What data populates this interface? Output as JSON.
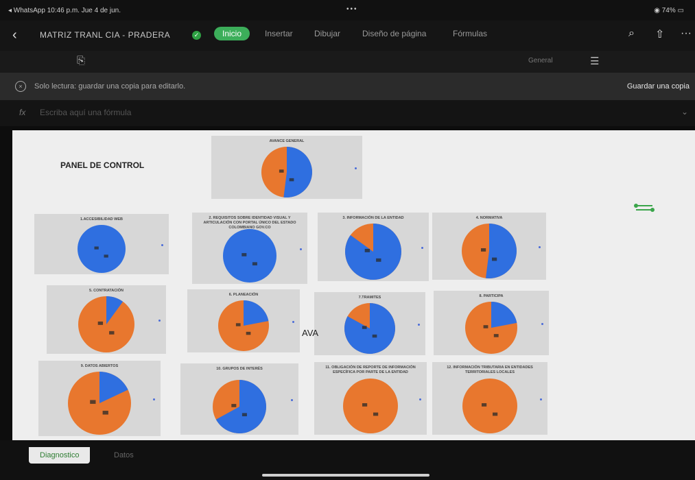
{
  "status": {
    "left": "◂ WhatsApp  10:46 p.m.  Jue 4 de jun.",
    "center": "•••",
    "right": "74%"
  },
  "title": {
    "doc": "MATRIZ TRANL CIA - PRADERA"
  },
  "tabs": [
    "Inicio",
    "Insertar",
    "Dibujar",
    "Diseño de página",
    "Fórmulas"
  ],
  "toolbar": {
    "general": "General"
  },
  "banner": {
    "message": "Solo lectura: guardar una copia para editarlo.",
    "save_copy": "Guardar una copia"
  },
  "formula": {
    "fx": "fx",
    "placeholder": "Escriba aquí una fórmula"
  },
  "sheet": {
    "panel_title": "PANEL DE CONTROL",
    "overlay_text": "AVA",
    "charts": [
      {
        "title": "AVANCE GENERAL",
        "blue": 0.52
      },
      {
        "title": "1.ACCESIBILIDAD WEB",
        "blue": 1.0
      },
      {
        "title": "2. REQUISITOS SOBRE IDENTIDAD VISUAL Y ARTICULACIÓN CON PORTAL ÚNICO DEL ESTADO COLOMBIANO GOV.CO",
        "blue": 1.0
      },
      {
        "title": "3. INFORMACIÓN DE LA ENTIDAD",
        "blue": 0.85
      },
      {
        "title": "4. NORMATIVA",
        "blue": 0.52
      },
      {
        "title": "5. CONTRATACIÓN",
        "blue": 0.1
      },
      {
        "title": "6. PLANEACIÓN",
        "blue": 0.22
      },
      {
        "title": "7.TRAMITES",
        "blue": 0.83
      },
      {
        "title": "8. PARTICIPA",
        "blue": 0.22
      },
      {
        "title": "9. DATOS ABIERTOS",
        "blue": 0.18
      },
      {
        "title": "10. GRUPOS DE INTERÉS",
        "blue": 0.67
      },
      {
        "title": "11. OBLIGACIÓN DE REPORTE DE INFORMACIÓN ESPECÍFICA POR PARTE DE LA ENTIDAD",
        "blue": 0.0
      },
      {
        "title": "12. INFORMACIÓN TRIBUTARIA EN ENTIDADES TERRITORIALES LOCALES",
        "blue": 0.0
      }
    ]
  },
  "sheet_tabs": [
    "Diagnostico",
    "Datos"
  ],
  "colors": {
    "blue": "#2f6fe0",
    "orange": "#e8772e",
    "accent": "#3cae5a"
  }
}
